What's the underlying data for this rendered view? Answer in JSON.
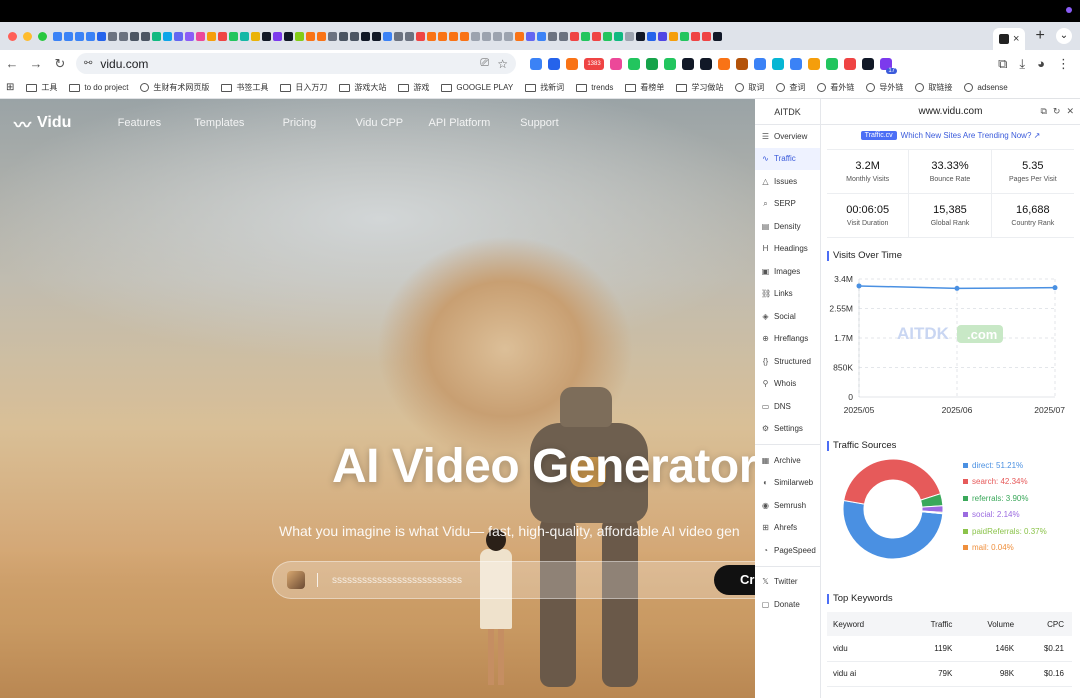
{
  "browser": {
    "tab_strip_icon_colors": [
      "#3b82f6",
      "#3b82f6",
      "#3b82f6",
      "#3b82f6",
      "#2563eb",
      "#6b7280",
      "#6b7280",
      "#4b5563",
      "#4b5563",
      "#10b981",
      "#0ea5e9",
      "#6366f1",
      "#8b5cf6",
      "#ec4899",
      "#f59e0b",
      "#ef4444",
      "#22c55e",
      "#14b8a6",
      "#eab308",
      "#111827",
      "#7c3aed",
      "#111827",
      "#84cc16",
      "#f97316",
      "#f97316",
      "#6b7280",
      "#4b5563",
      "#4b5563",
      "#111827",
      "#111827",
      "#3b82f6",
      "#6b7280",
      "#6b7280",
      "#ef4444",
      "#f97316",
      "#f97316",
      "#f97316",
      "#f97316",
      "#9ca3af",
      "#9ca3af",
      "#9ca3af",
      "#9ca3af",
      "#f97316",
      "#6366f1",
      "#3b82f6",
      "#6b7280",
      "#6b7280",
      "#ef4444",
      "#22c55e",
      "#ef4444",
      "#22c55e",
      "#10b981",
      "#9ca3af",
      "#111827",
      "#2563eb",
      "#4f46e5",
      "#f59e0b",
      "#22c55e",
      "#ef4444",
      "#ef4444",
      "#111827"
    ],
    "active_tab_close": "×",
    "new_tab": "+",
    "url": "vidu.com",
    "toolbar_icon_colors": [
      "#3b82f6",
      "#2563eb",
      "#f97316",
      "#ef4444",
      "#ec4899",
      "#22c55e",
      "#16a34a",
      "#22c55e",
      "#111827",
      "#111827",
      "#f97316",
      "#b45309",
      "#3b82f6",
      "#06b6d4",
      "#3b82f6",
      "#f59e0b",
      "#22c55e",
      "#ef4444",
      "#111827",
      "#7c3aed"
    ],
    "ext_badge_1": "1383",
    "ext_badge_2": "17",
    "bookmarks": [
      {
        "label": "工具",
        "icon": "folder-icon"
      },
      {
        "label": "to do project",
        "icon": "folder-icon"
      },
      {
        "label": "生财有术网页版",
        "icon": "globe-icon"
      },
      {
        "label": "书签工具",
        "icon": "folder-icon"
      },
      {
        "label": "日入万刀",
        "icon": "folder-icon"
      },
      {
        "label": "游戏大站",
        "icon": "folder-icon"
      },
      {
        "label": "游戏",
        "icon": "folder-icon"
      },
      {
        "label": "GOOGLE PLAY",
        "icon": "folder-icon"
      },
      {
        "label": "找新词",
        "icon": "folder-icon"
      },
      {
        "label": "trends",
        "icon": "folder-icon"
      },
      {
        "label": "看榜单",
        "icon": "folder-icon"
      },
      {
        "label": "学习做站",
        "icon": "folder-icon"
      },
      {
        "label": "取词",
        "icon": "globe-icon"
      },
      {
        "label": "查词",
        "icon": "globe-icon"
      },
      {
        "label": "看外链",
        "icon": "globe-icon"
      },
      {
        "label": "导外链",
        "icon": "globe-icon"
      },
      {
        "label": "取链接",
        "icon": "globe-icon"
      },
      {
        "label": "adsense",
        "icon": "globe-icon"
      }
    ]
  },
  "site": {
    "logo": "Vidu",
    "nav": [
      "Features",
      "Templates",
      "Pricing",
      "Vidu CPP",
      "API Platform",
      "Support"
    ],
    "hero_title": "AI Video Generator",
    "hero_subtitle": "What you imagine is what Vidu— fast, high-quality, affordable AI video gen",
    "prompt_text": "ssssssssssssssssssssssssss",
    "create_label": "Cre"
  },
  "panel": {
    "brand": "AITDK",
    "domain": "www.vidu.com",
    "promo_tag": "Traffic.cv",
    "promo_text": "Which New Sites Are Trending Now? ↗",
    "sidebar": [
      {
        "label": "Overview",
        "icon": "☰",
        "name": "overview"
      },
      {
        "label": "Traffic",
        "icon": "∿",
        "name": "traffic",
        "active": true
      },
      {
        "label": "Issues",
        "icon": "△",
        "name": "issues"
      },
      {
        "label": "SERP",
        "icon": "⌕",
        "name": "serp"
      },
      {
        "label": "Density",
        "icon": "▤",
        "name": "density"
      },
      {
        "label": "Headings",
        "icon": "H",
        "name": "headings"
      },
      {
        "label": "Images",
        "icon": "▣",
        "name": "images"
      },
      {
        "label": "Links",
        "icon": "⛓",
        "name": "links"
      },
      {
        "label": "Social",
        "icon": "◈",
        "name": "social"
      },
      {
        "label": "Hreflangs",
        "icon": "⊕",
        "name": "hreflangs"
      },
      {
        "label": "Structured",
        "icon": "{}",
        "name": "structured"
      },
      {
        "label": "Whois",
        "icon": "⚲",
        "name": "whois"
      },
      {
        "label": "DNS",
        "icon": "▭",
        "name": "dns"
      },
      {
        "label": "Settings",
        "icon": "⚙",
        "name": "settings"
      }
    ],
    "sidebar_tools": [
      {
        "label": "Archive",
        "icon": "▦",
        "name": "archive"
      },
      {
        "label": "Similarweb",
        "icon": "◐",
        "name": "similarweb"
      },
      {
        "label": "Semrush",
        "icon": "◉",
        "name": "semrush"
      },
      {
        "label": "Ahrefs",
        "icon": "⊞",
        "name": "ahrefs"
      },
      {
        "label": "PageSpeed",
        "icon": "◔",
        "name": "pagespeed"
      }
    ],
    "sidebar_footer": [
      {
        "label": "Twitter",
        "icon": "𝕏",
        "name": "twitter"
      },
      {
        "label": "Donate",
        "icon": "▢",
        "name": "donate"
      }
    ],
    "metrics": [
      {
        "value": "3.2M",
        "label": "Monthly Visits"
      },
      {
        "value": "33.33%",
        "label": "Bounce Rate"
      },
      {
        "value": "5.35",
        "label": "Pages Per Visit"
      },
      {
        "value": "00:06:05",
        "label": "Visit Duration"
      },
      {
        "value": "15,385",
        "label": "Global Rank"
      },
      {
        "value": "16,688",
        "label": "Country Rank"
      }
    ],
    "visits_title": "Visits Over Time",
    "watermark": "AITDK",
    "watermark_suffix": ".com",
    "sources_title": "Traffic Sources",
    "keywords_title": "Top Keywords",
    "keyword_headers": [
      "Keyword",
      "Traffic",
      "Volume",
      "CPC"
    ],
    "keywords": [
      [
        "vidu",
        "119K",
        "146K",
        "$0.21"
      ],
      [
        "vidu ai",
        "79K",
        "98K",
        "$0.16"
      ]
    ]
  },
  "chart_data": [
    {
      "type": "line",
      "title": "Visits Over Time",
      "x": [
        "2025/05",
        "2025/06",
        "2025/07"
      ],
      "values": [
        3200000,
        3130000,
        3150000
      ],
      "yticks": [
        "0",
        "850K",
        "1.7M",
        "2.55M",
        "3.4M"
      ],
      "ylim": [
        0,
        3400000
      ],
      "grid": true,
      "color": "#4a90e2"
    },
    {
      "type": "pie",
      "title": "Traffic Sources",
      "slices": [
        {
          "name": "direct",
          "value": 51.21,
          "label": "direct: 51.21%",
          "color": "#4a90e2"
        },
        {
          "name": "search",
          "value": 42.34,
          "label": "search: 42.34%",
          "color": "#e65a5a"
        },
        {
          "name": "referrals",
          "value": 3.9,
          "label": "referrals: 3.90%",
          "color": "#3aa85a"
        },
        {
          "name": "social",
          "value": 2.14,
          "label": "social: 2.14%",
          "color": "#9b6be0"
        },
        {
          "name": "paidReferrals",
          "value": 0.37,
          "label": "paidReferrals: 0.37%",
          "color": "#8bc34a"
        },
        {
          "name": "mail",
          "value": 0.04,
          "label": "mail: 0.04%",
          "color": "#ef8f3c"
        }
      ]
    }
  ]
}
